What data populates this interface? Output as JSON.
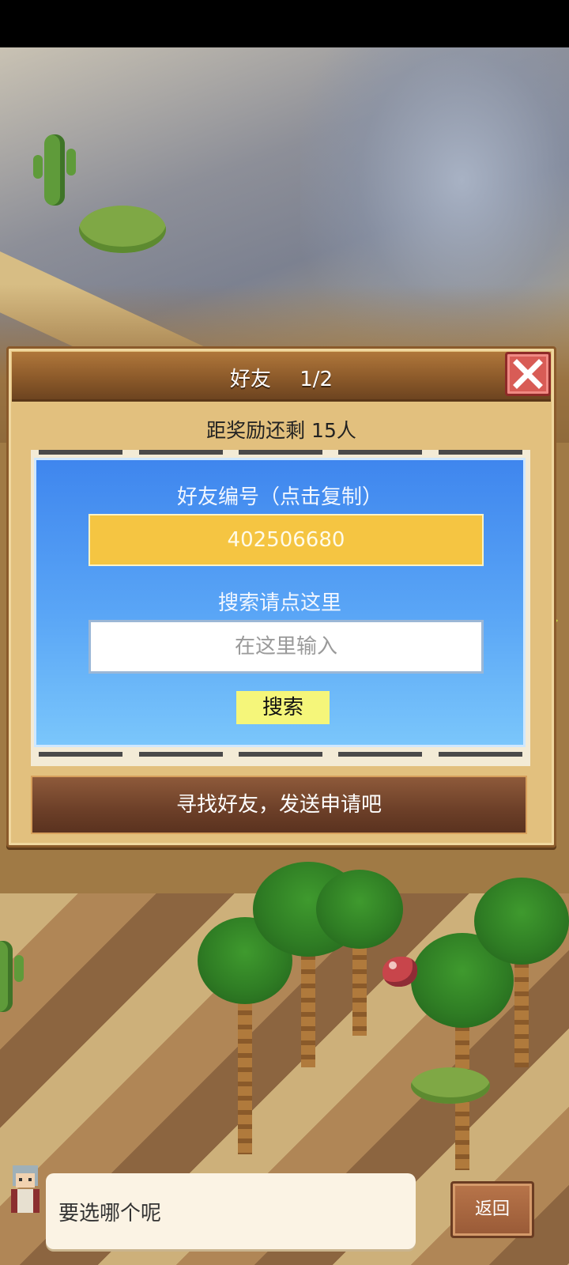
{
  "panel": {
    "title": "好友",
    "page_indicator": "1/2",
    "reward_text": "距奖励还剩 15人",
    "friend_id_label": "好友编号（点击复制）",
    "friend_id_value": "402506680",
    "search_label": "搜索请点这里",
    "search_placeholder": "在这里输入",
    "search_button": "搜索",
    "hint_text": "寻找好友，发送申请吧"
  },
  "dialog": {
    "message": "要选哪个呢",
    "back_button": "返回"
  },
  "colors": {
    "panel_bg": "#e2c07e",
    "card_blue": "#3f86ee",
    "id_box": "#f5c542",
    "search_button": "#f5f67a",
    "close_button": "#d85c56"
  },
  "icons": [
    "close-icon",
    "arrow-left-icon",
    "arrow-right-icon"
  ]
}
